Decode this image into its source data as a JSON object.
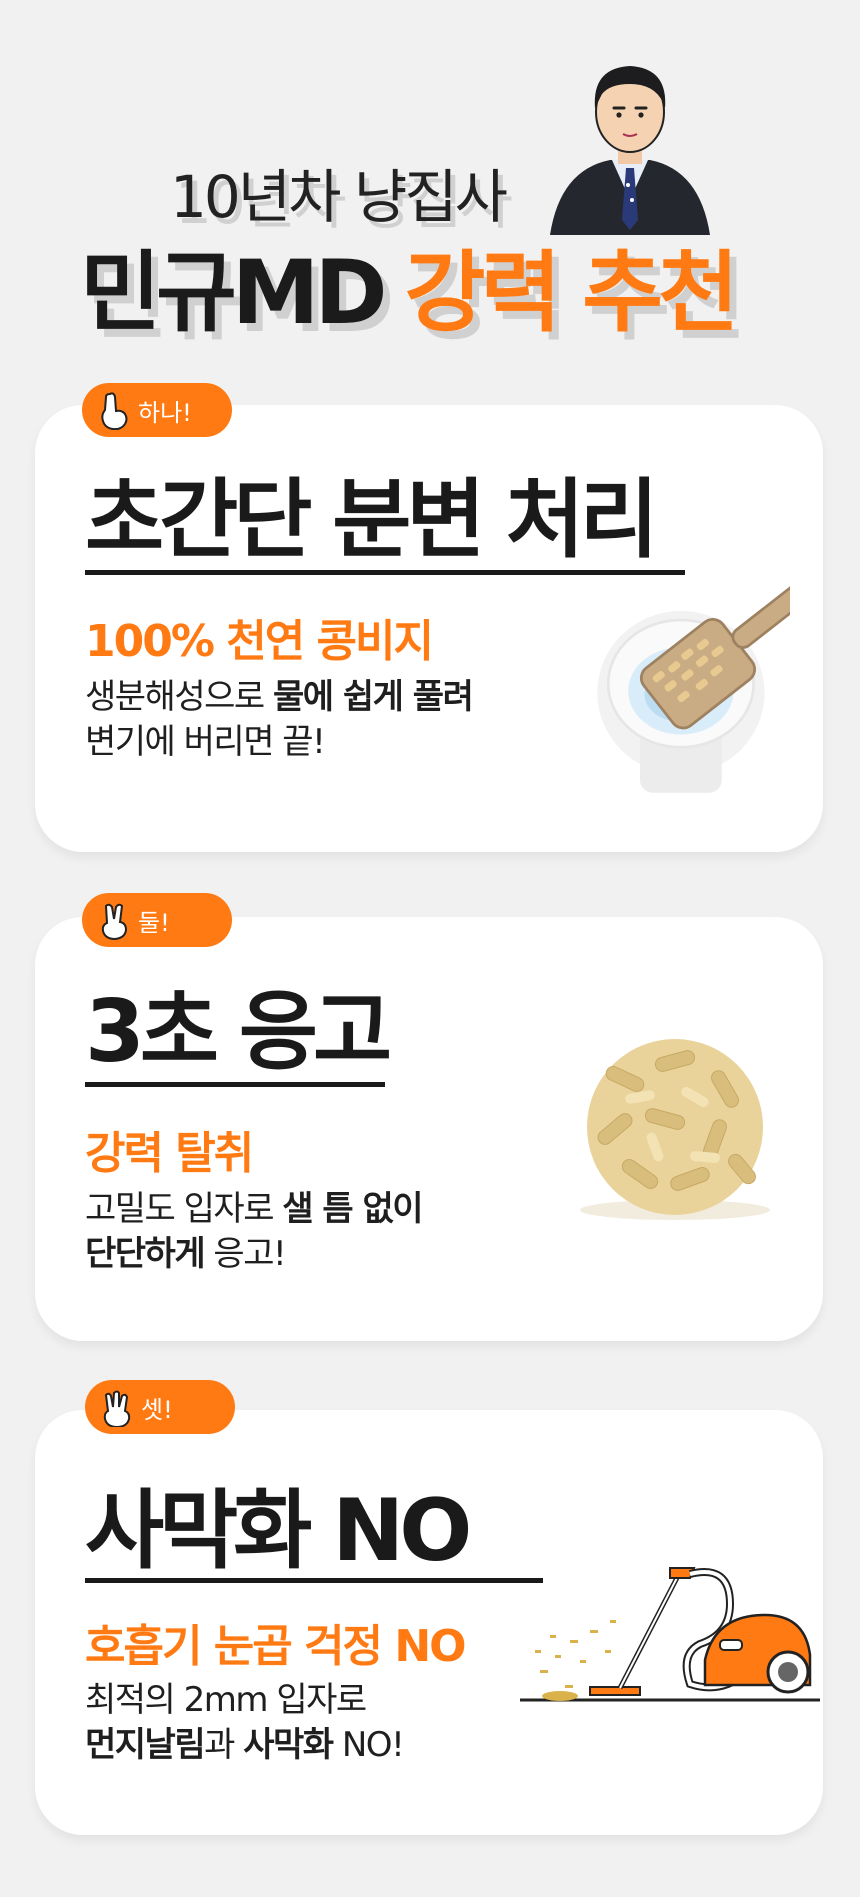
{
  "header": {
    "subtitle": "10년차 냥집사",
    "title_black": "민규MD",
    "title_orange": "강력 추천",
    "avatar_icon": "man-in-suit-avatar"
  },
  "colors": {
    "accent": "#ff7a12",
    "background": "#f1f1f1",
    "card": "#ffffff",
    "text": "#1a1a1a"
  },
  "cards": [
    {
      "badge": "하나!",
      "badge_icon": "one-finger-hand-icon",
      "title": "초간단 분변 처리",
      "highlight": "100% 천연 콩비지",
      "line1_plain": "생분해성으로 ",
      "line1_bold": "물에 쉽게 풀려",
      "line2_plain": "변기에 버리면 끝!",
      "illustration": "scoop-over-toilet-illustration"
    },
    {
      "badge": "둘!",
      "badge_icon": "two-finger-hand-icon",
      "title": "3초 응고",
      "highlight": "강력 탈취",
      "line1_plain": "고밀도 입자로 ",
      "line1_bold": "샐 틈 없이",
      "line2_bold": "단단하게",
      "line2_plain": " 응고!",
      "illustration": "clumped-litter-ball-illustration"
    },
    {
      "badge": "셋!",
      "badge_icon": "three-finger-hand-icon",
      "title": "사막화 NO",
      "highlight": "호흡기 눈곱 걱정 NO",
      "line1_plain": "최적의 2mm 입자로",
      "line2_bold_a": "먼지날림",
      "line2_plain_a": "과 ",
      "line2_bold_b": "사막화",
      "line2_plain_b": " NO!",
      "illustration": "vacuum-cleaner-illustration"
    }
  ]
}
